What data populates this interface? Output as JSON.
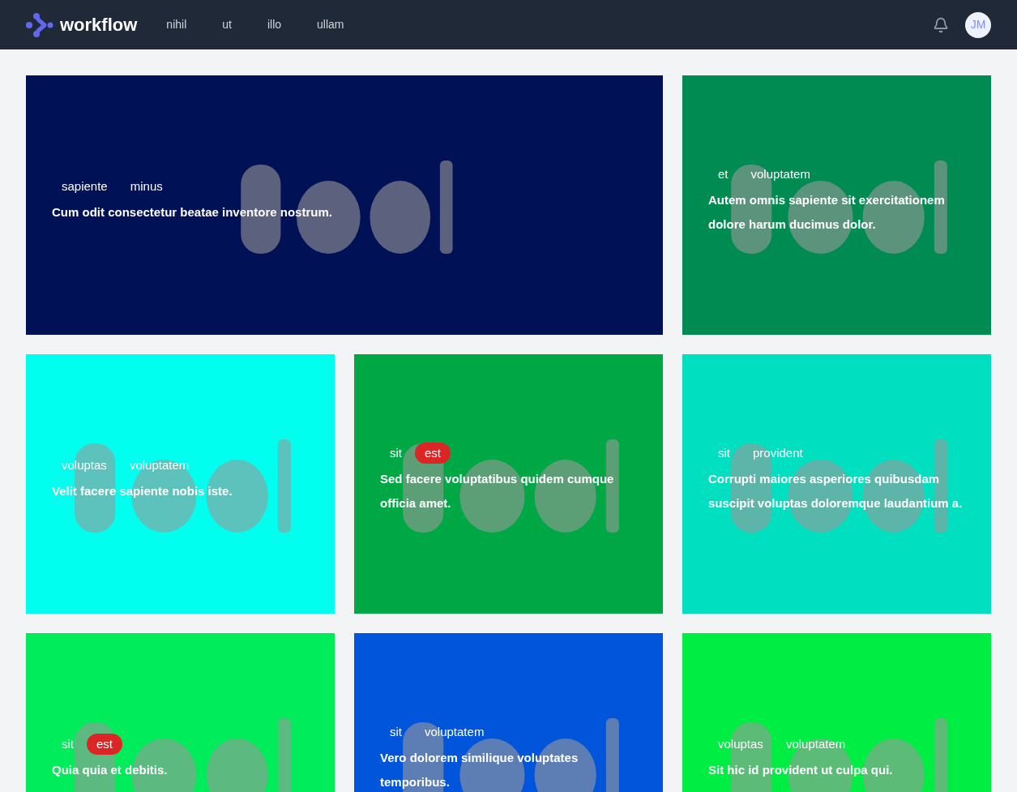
{
  "header": {
    "brand": "workflow",
    "nav": [
      {
        "label": "nihil"
      },
      {
        "label": "ut"
      },
      {
        "label": "illo"
      },
      {
        "label": "ullam"
      }
    ],
    "avatar": "JM"
  },
  "cards": [
    {
      "color": "#001156",
      "wide": true,
      "kind": "picture",
      "tags": [
        {
          "label": "sapiente",
          "highlighted": false
        },
        {
          "label": "minus",
          "highlighted": false
        }
      ],
      "title": "Cum odit consectetur beatae inventore nostrum."
    },
    {
      "color": "#008b52",
      "wide": false,
      "kind": "picture",
      "tags": [
        {
          "label": "et",
          "highlighted": false
        },
        {
          "label": "voluptatem",
          "highlighted": false
        }
      ],
      "title": "Autem omnis sapiente sit exercitationem dolore harum ducimus dolor."
    },
    {
      "color": "#00ffee",
      "wide": false,
      "kind": "picture",
      "tags": [
        {
          "label": "voluptas",
          "highlighted": false
        },
        {
          "label": "voluptatem",
          "highlighted": false
        }
      ],
      "title": "Velit facere sapiente nobis iste."
    },
    {
      "color": "#00a845",
      "wide": false,
      "kind": "picture",
      "tags": [
        {
          "label": "sit",
          "highlighted": false
        },
        {
          "label": "est",
          "highlighted": true
        }
      ],
      "title": "Sed facere voluptatibus quidem cumque officia amet."
    },
    {
      "color": "#00dfbf",
      "wide": false,
      "kind": "picture",
      "tags": [
        {
          "label": "sit",
          "highlighted": false
        },
        {
          "label": "provident",
          "highlighted": false
        }
      ],
      "title": "Corrupti maiores asperiores quibusdam suscipit voluptas doloremque laudantium a."
    },
    {
      "color": "#00ec5a",
      "wide": false,
      "kind": "picture",
      "tags": [
        {
          "label": "sit",
          "highlighted": false
        },
        {
          "label": "est",
          "highlighted": true
        }
      ],
      "title": "Quia quia et debitis."
    },
    {
      "color": "#0055db",
      "wide": false,
      "kind": "picture",
      "tags": [
        {
          "label": "sit",
          "highlighted": false
        },
        {
          "label": "voluptatem",
          "highlighted": false
        }
      ],
      "title": "Vero dolorem similique voluptates temporibus."
    },
    {
      "color": "#00ee44",
      "wide": false,
      "kind": "picture",
      "tags": [
        {
          "label": "voluptas",
          "highlighted": false
        },
        {
          "label": "voluptatem",
          "highlighted": false
        }
      ],
      "title": "Sit hic id provident ut culpa qui."
    }
  ]
}
